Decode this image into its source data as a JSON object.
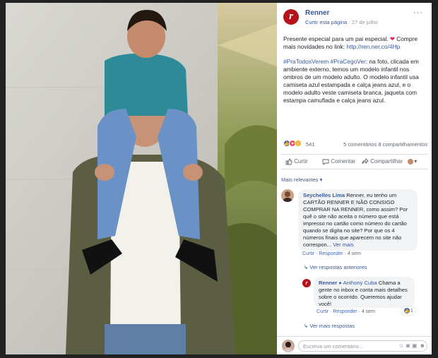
{
  "post": {
    "page_name": "Renner",
    "follow_label": "Curtir esta página",
    "separator": " · ",
    "date": "27 de julho",
    "more_label": "···",
    "text_line1": "Presente especial para um pai especial. ",
    "text_line1_tail": " Compre mais novidades no link: ",
    "link": "http://ren.ner.co/4Hp",
    "hashtags": "#PraTodosVerem #PraCegoVer",
    "description": ": na foto, clicada em ambiente externo, temos um modelo infantil nos ombros de um modelo adulto. O modelo infantil usa camiseta azul estampada e calça jeans azul, e o modelo adulto veste camiseta branca, jaqueta com estampa camuflada e calça jeans azul.",
    "reaction_count": "541",
    "comments_count": "5 comentários",
    "shares_count": "8 compartilhamentos"
  },
  "actions": {
    "like": "Curtir",
    "comment": "Comentar",
    "share": "Compartilhar"
  },
  "sort_label": "Mais relevantes",
  "comment1": {
    "author": "Seychelles Lima",
    "text": " Renner, eu tenho um CARTÃO RENNER E NÃO CONSIGO COMPRAR NA RENNER, como assim? Por quê o site não aceita o número que está impresso no cartão como número do cartão quando se digita no site? Por que os 4 números finais que aparecem no site não correspon... ",
    "see_more": "Ver mais",
    "like": "Curtir",
    "reply": "Responder",
    "time": "4 sem"
  },
  "view_prev_replies": "Ver respostas anteriores",
  "reply1": {
    "author": "Renner",
    "mention": "Anthony Cuba",
    "text": " Chama a gente no inbox e conta mais detalhes sobre o ocorrido. Queremos ajudar você!",
    "like": "Curtir",
    "reply": "Responder",
    "time": "4 sem",
    "reaction_count": "1"
  },
  "view_more_replies": "Ver mais respostas",
  "composer": {
    "placeholder": "Escreva um comentário..."
  },
  "colors": {
    "brand": "#b5121b",
    "link": "#365899",
    "like": "#4267b2"
  }
}
